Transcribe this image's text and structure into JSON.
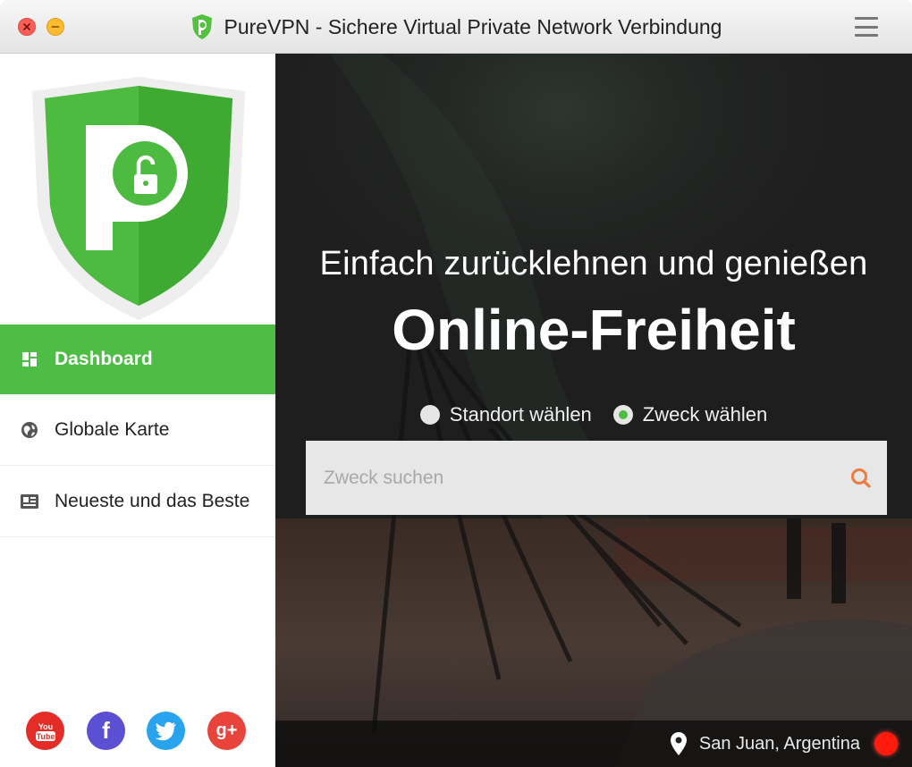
{
  "window": {
    "title": "PureVPN - Sichere Virtual Private Network Verbindung"
  },
  "sidebar": {
    "items": [
      {
        "label": "Dashboard",
        "icon": "dashboard-icon",
        "active": true
      },
      {
        "label": "Globale Karte",
        "icon": "globe-icon",
        "active": false
      },
      {
        "label": "Neueste und das Beste",
        "icon": "news-icon",
        "active": false
      }
    ],
    "socials": [
      {
        "name": "youtube",
        "glyph": "You Tube",
        "color": "#e52d27"
      },
      {
        "name": "facebook",
        "glyph": "f",
        "color": "#5b4fd3"
      },
      {
        "name": "twitter",
        "glyph": "twitter-bird",
        "color": "#2aa3ef"
      },
      {
        "name": "google-plus",
        "glyph": "g+",
        "color": "#e8443b"
      }
    ]
  },
  "main": {
    "subtitle": "Einfach zurücklehnen und genießen",
    "headline": "Online-Freiheit",
    "options": [
      {
        "label": "Standort wählen",
        "selected": false
      },
      {
        "label": "Zweck wählen",
        "selected": true
      }
    ],
    "search": {
      "placeholder": "Zweck suchen",
      "value": ""
    }
  },
  "status": {
    "location": "San Juan, Argentina",
    "connection_color": "#ff1a0e"
  },
  "colors": {
    "brand_green": "#4ebd45",
    "search_accent": "#f07b3f",
    "panel_dark": "#1c1c1c"
  }
}
